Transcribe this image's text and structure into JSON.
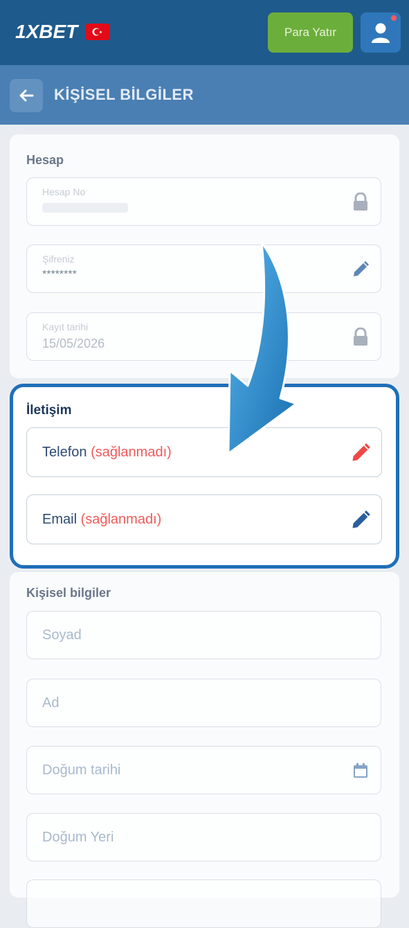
{
  "header": {
    "logo_text": "1XBET",
    "flag_icon": "turkey-flag-icon",
    "deposit_label": "Para Yatır",
    "user_icon": "user-icon"
  },
  "subheader": {
    "back_icon": "arrow-left-icon",
    "title": "KİŞİSEL BİLGİLER"
  },
  "account": {
    "section_title": "Hesap",
    "fields": [
      {
        "label": "Hesap No",
        "value": "",
        "icon": "lock-icon"
      },
      {
        "label": "Şifreniz",
        "value": "********",
        "icon": "pencil-icon"
      },
      {
        "label": "Kayıt tarihi",
        "value": "15/05/2026",
        "icon": "lock-icon"
      }
    ]
  },
  "contact": {
    "section_title": "İletişim",
    "phone_label": "Telefon",
    "phone_status": "(sağlanmadı)",
    "email_label": "Email",
    "email_status": "(sağlanmadı)"
  },
  "personal": {
    "section_title": "Kişisel bilgiler",
    "fields": [
      {
        "placeholder": "Soyad"
      },
      {
        "placeholder": "Ad"
      },
      {
        "placeholder": "Doğum tarihi",
        "icon": "calendar-icon"
      },
      {
        "placeholder": "Doğum Yeri"
      }
    ]
  },
  "colors": {
    "header_bg": "#1f5a8c",
    "subheader_bg": "#4a7fb3",
    "deposit_green": "#6cae3b",
    "highlight_border": "#1f6fb8",
    "status_red": "#f05a5a",
    "pencil_red": "#f04848",
    "pencil_blue": "#2a5f9c"
  }
}
